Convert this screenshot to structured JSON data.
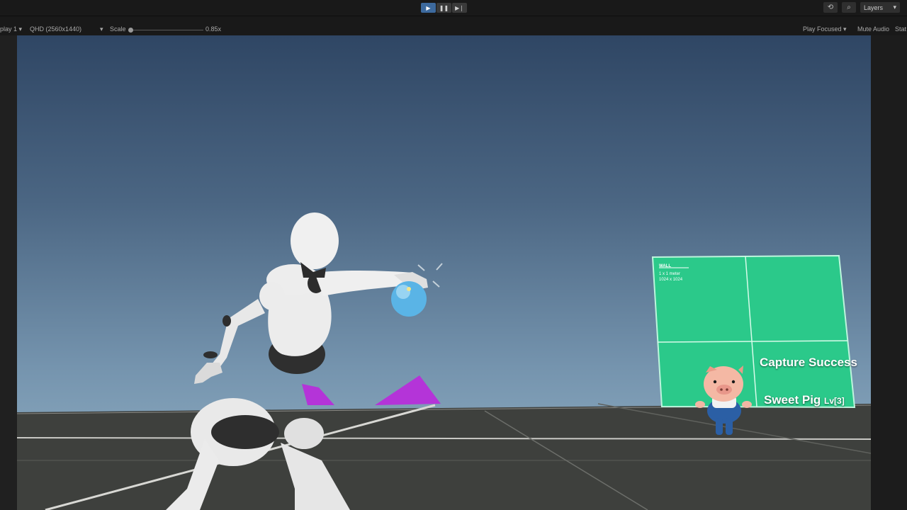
{
  "editor": {
    "display_label": "play 1",
    "resolution_label": "QHD (2560x1440)",
    "scale_label": "Scale",
    "scale_value": "0.85x",
    "play_focused_label": "Play Focused",
    "mute_audio_label": "Mute Audio",
    "stats_label": "Stat",
    "layers_label": "Layers",
    "play_state": "playing"
  },
  "icons": {
    "play": "play-icon",
    "pause": "pause-icon",
    "step": "step-icon",
    "history": "history-icon",
    "search": "search-icon",
    "dropdown": "chevron-down-icon"
  },
  "game": {
    "wall_label_title": "WALL",
    "wall_label_line1": "1 x 1 meter",
    "wall_label_line2": "1024 x 1024",
    "capture_message": "Capture Success",
    "creature_name": "Sweet Pig",
    "creature_level": "Lv[3]",
    "colors": {
      "sky_top": "#2f4664",
      "sky_bottom": "#94b2c6",
      "ground": "#3e403d",
      "wall": "#2bc98a",
      "markers": "#b434d8",
      "capture_ball": "#5ab4e6"
    }
  }
}
